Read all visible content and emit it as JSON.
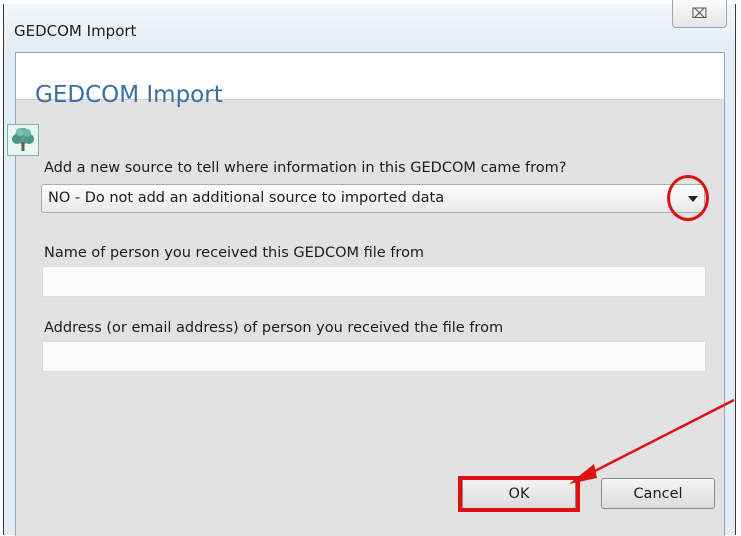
{
  "window": {
    "title": "GEDCOM Import",
    "close_glyph": "⌧"
  },
  "dialog": {
    "header_title": "GEDCOM Import",
    "icon": "tree-icon"
  },
  "source_question": {
    "label": "Add a new source to tell where information in this GEDCOM came from?",
    "selected": "NO - Do not add an additional source to imported data"
  },
  "person_name": {
    "label": "Name of person you received this GEDCOM file from",
    "value": ""
  },
  "address": {
    "label": "Address (or email address) of person you received the file from",
    "value": ""
  },
  "buttons": {
    "ok": "OK",
    "cancel": "Cancel"
  },
  "annotations": {
    "color": "#e01010"
  }
}
